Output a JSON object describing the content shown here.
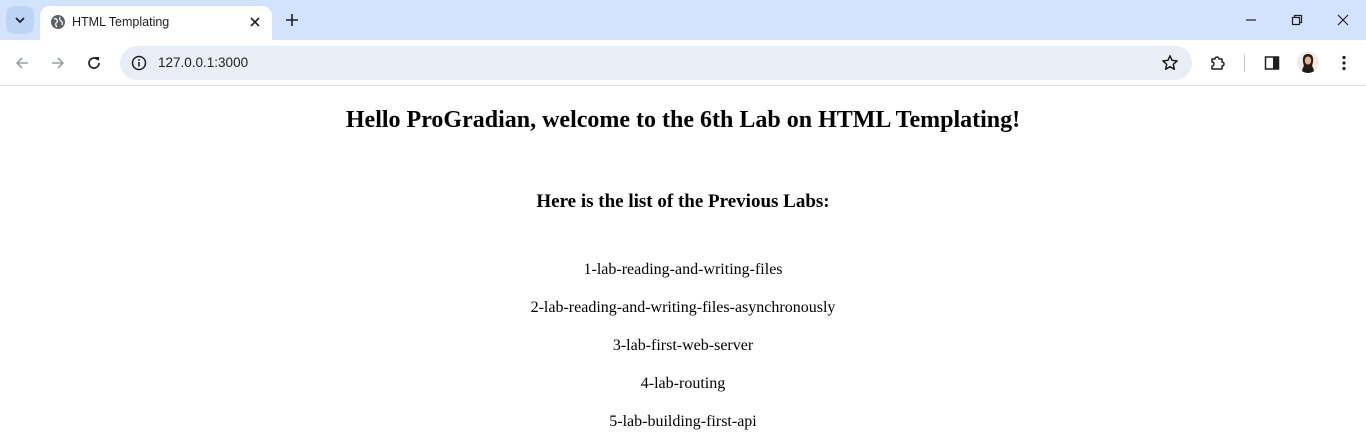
{
  "browser": {
    "tab_title": "HTML Templating",
    "url": "127.0.0.1:3000",
    "icons": {
      "tab_search": "chevron-down-icon",
      "favicon": "globe-icon",
      "tab_close": "close-icon",
      "new_tab": "plus-icon",
      "back": "arrow-left-icon",
      "forward": "arrow-right-icon",
      "reload": "reload-icon",
      "site_info": "info-icon",
      "bookmark": "star-icon",
      "extensions": "puzzle-icon",
      "side_panel": "side-panel-icon",
      "profile": "avatar",
      "menu": "more-vertical-icon",
      "minimize": "minimize-icon",
      "restore": "restore-icon",
      "close_window": "close-icon"
    },
    "colors": {
      "tabstrip": "#d3e3fd",
      "omnibox": "#e9eef6"
    }
  },
  "page": {
    "heading": "Hello ProGradian, welcome to the 6th Lab on HTML Templating!",
    "subheading": "Here is the list of the Previous Labs:",
    "labs": [
      "1-lab-reading-and-writing-files",
      "2-lab-reading-and-writing-files-asynchronously",
      "3-lab-first-web-server",
      "4-lab-routing",
      "5-lab-building-first-api"
    ]
  }
}
